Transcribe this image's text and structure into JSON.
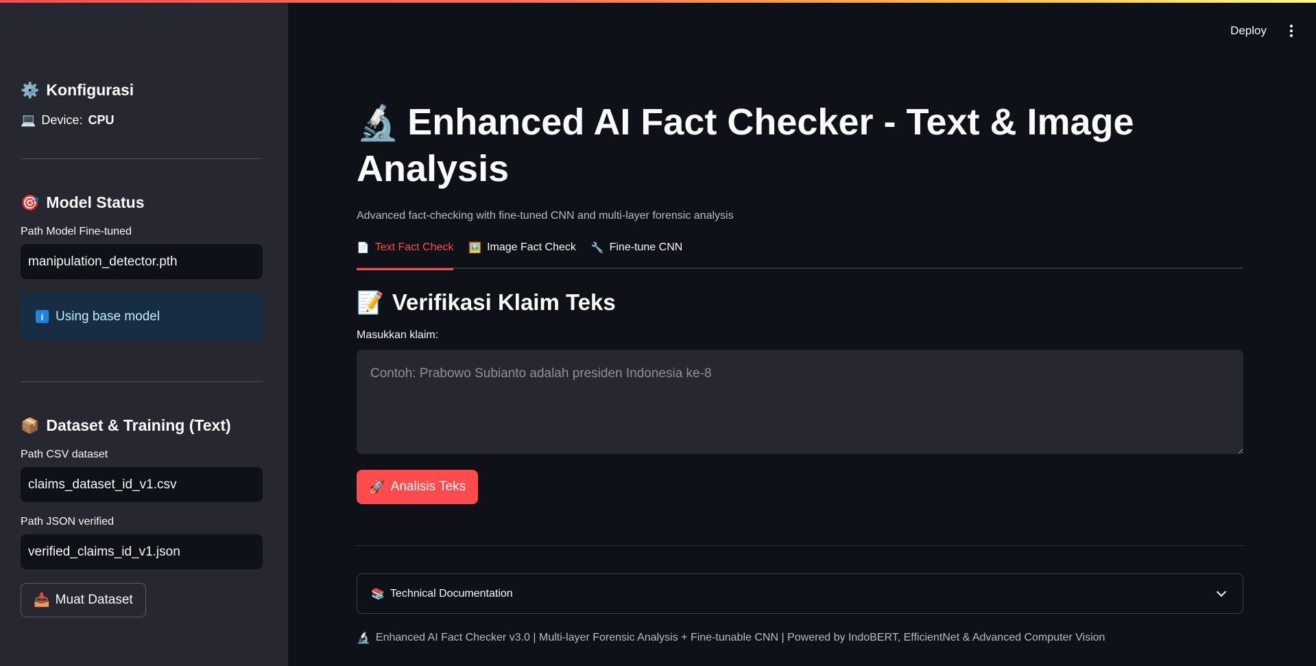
{
  "header": {
    "deploy_label": "Deploy"
  },
  "sidebar": {
    "config_title": "Konfigurasi",
    "device_label": "Device:",
    "device_value": "CPU",
    "model_status_title": "Model Status",
    "model_path_label": "Path Model Fine-tuned",
    "model_path_value": "manipulation_detector.pth",
    "info_text": "Using base model",
    "dataset_title": "Dataset & Training (Text)",
    "csv_label": "Path CSV dataset",
    "csv_value": "claims_dataset_id_v1.csv",
    "json_label": "Path JSON verified",
    "json_value": "verified_claims_id_v1.json",
    "load_button": "Muat Dataset"
  },
  "main": {
    "title": "Enhanced AI Fact Checker - Text & Image Analysis",
    "subtitle": "Advanced fact-checking with fine-tuned CNN and multi-layer forensic analysis",
    "tabs": [
      {
        "label": "Text Fact Check",
        "icon": "📄"
      },
      {
        "label": "Image Fact Check",
        "icon": "🖼️"
      },
      {
        "label": "Fine-tune CNN",
        "icon": "🔧"
      }
    ],
    "section_title": "Verifikasi Klaim Teks",
    "claim_label": "Masukkan klaim:",
    "claim_placeholder": "Contoh: Prabowo Subianto adalah presiden Indonesia ke-8",
    "analyze_button": "Analisis Teks",
    "expander_label": "Technical Documentation",
    "footer": "Enhanced AI Fact Checker v3.0 | Multi-layer Forensic Analysis + Fine-tunable CNN | Powered by IndoBERT, EfficientNet & Advanced Computer Vision"
  },
  "colors": {
    "accent": "#ff4b4b",
    "sidebar_bg": "#262730",
    "main_bg": "#0e1117",
    "info_bg": "#172d43"
  }
}
